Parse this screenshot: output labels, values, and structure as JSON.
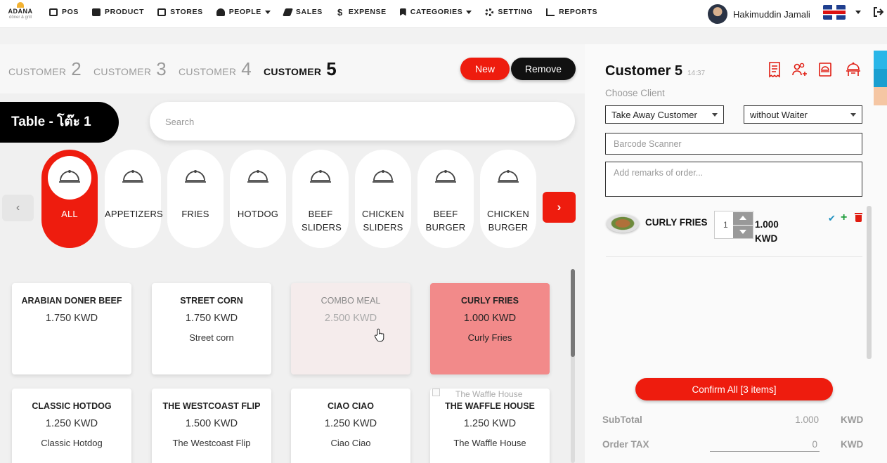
{
  "brand": {
    "name": "ADANA",
    "tagline": "döner & grill"
  },
  "nav": [
    {
      "label": "POS",
      "icon": "pos-icon",
      "dropdown": false
    },
    {
      "label": "PRODUCT",
      "icon": "product-icon",
      "dropdown": false
    },
    {
      "label": "STORES",
      "icon": "stores-icon",
      "dropdown": false
    },
    {
      "label": "PEOPLE",
      "icon": "people-icon",
      "dropdown": true
    },
    {
      "label": "SALES",
      "icon": "sales-icon",
      "dropdown": false
    },
    {
      "label": "EXPENSE",
      "icon": "dollar-icon",
      "dropdown": false
    },
    {
      "label": "CATEGORIES",
      "icon": "bookmark-icon",
      "dropdown": true
    },
    {
      "label": "SETTING",
      "icon": "gears-icon",
      "dropdown": false
    },
    {
      "label": "REPORTS",
      "icon": "chart-icon",
      "dropdown": false
    }
  ],
  "user": {
    "name": "Hakimuddin Jamali",
    "flag": "uk-flag-icon"
  },
  "customer_tabs": [
    {
      "label": "CUSTOMER",
      "number": "2",
      "active": false
    },
    {
      "label": "CUSTOMER",
      "number": "3",
      "active": false
    },
    {
      "label": "CUSTOMER",
      "number": "4",
      "active": false
    },
    {
      "label": "CUSTOMER",
      "number": "5",
      "active": true
    }
  ],
  "actions": {
    "new_label": "New",
    "remove_label": "Remove"
  },
  "table_label": "Table - โต๊ะ 1",
  "search": {
    "placeholder": "Search"
  },
  "categories": [
    {
      "label": "ALL",
      "active": true
    },
    {
      "label": "APPETIZERS",
      "active": false
    },
    {
      "label": "FRIES",
      "active": false
    },
    {
      "label": "HOTDOG",
      "active": false
    },
    {
      "label": "BEEF SLIDERS",
      "active": false
    },
    {
      "label": "CHICKEN SLIDERS",
      "active": false
    },
    {
      "label": "BEEF BURGER",
      "active": false
    },
    {
      "label": "CHICKEN BURGER",
      "active": false
    }
  ],
  "nav_arrows": {
    "prev": "‹",
    "next": "›"
  },
  "products": [
    {
      "name": "ARABIAN DONER BEEF",
      "price": "1.750 KWD",
      "desc": "",
      "state": "normal"
    },
    {
      "name": "STREET CORN",
      "price": "1.750 KWD",
      "desc": "Street corn",
      "state": "normal"
    },
    {
      "name": "COMBO MEAL",
      "price": "2.500 KWD",
      "desc": "",
      "state": "faded"
    },
    {
      "name": "CURLY FRIES",
      "price": "1.000 KWD",
      "desc": "Curly Fries",
      "state": "selected"
    },
    {
      "name": "CLASSIC HOTDOG",
      "price": "1.250 KWD",
      "desc": "Classic Hotdog",
      "state": "normal"
    },
    {
      "name": "THE WESTCOAST FLIP",
      "price": "1.500 KWD",
      "desc": "The Westcoast Flip",
      "state": "normal"
    },
    {
      "name": "CIAO CIAO",
      "price": "1.250 KWD",
      "desc": "Ciao Ciao",
      "state": "normal"
    },
    {
      "name": "THE WAFFLE HOUSE",
      "price": "1.250 KWD",
      "desc": "The Waffle House",
      "state": "normal"
    }
  ],
  "ghost_label": "The Waffle House",
  "order": {
    "title": "Customer 5",
    "time": "14:37",
    "choose_client": "Choose Client",
    "client": "Take Away Customer",
    "waiter": "without Waiter",
    "barcode_placeholder": "Barcode Scanner",
    "remarks_placeholder": "Add remarks of order...",
    "items": [
      {
        "name": "CURLY FRIES",
        "qty": "1",
        "price": "1.000",
        "currency": "KWD"
      }
    ],
    "confirm_label": "Confirm All [3 items]",
    "subtotal_label": "SubTotal",
    "subtotal_value": "1.000",
    "subtotal_currency": "KWD",
    "tax_label": "Order TAX",
    "tax_value": "0",
    "tax_currency": "KWD"
  },
  "colors": {
    "accent": "#ee1c0e",
    "dark": "#111111",
    "selected": "#f28a8a"
  }
}
